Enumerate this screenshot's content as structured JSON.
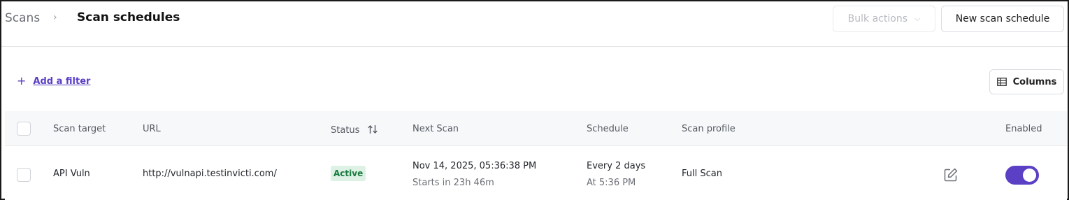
{
  "breadcrumb": {
    "root": "Scans",
    "current": "Scan schedules"
  },
  "header": {
    "bulk_actions_label": "Bulk actions",
    "new_button_label": "New scan schedule"
  },
  "filters": {
    "add_filter_label": "Add a filter"
  },
  "columns_button_label": "Columns",
  "table": {
    "headers": {
      "scan_target": "Scan target",
      "url": "URL",
      "status": "Status",
      "next_scan": "Next Scan",
      "schedule": "Schedule",
      "scan_profile": "Scan profile",
      "enabled": "Enabled"
    },
    "rows": [
      {
        "scan_target": "API Vuln",
        "url": "http://vulnapi.testinvicti.com/",
        "status": "Active",
        "next_scan": "Nov 14, 2025, 05:36:38 PM",
        "next_scan_sub": "Starts in 23h 46m",
        "schedule": "Every 2 days",
        "schedule_sub": "At 5:36 PM",
        "scan_profile": "Full Scan",
        "enabled": true
      }
    ]
  },
  "colors": {
    "accent": "#5b3fc4",
    "active_badge_bg": "#ddf2e4",
    "active_badge_text": "#1a7a3f"
  },
  "icons": [
    "chevron-right-icon",
    "chevron-down-icon",
    "plus-icon",
    "columns-icon",
    "sort-icon",
    "edit-icon"
  ]
}
